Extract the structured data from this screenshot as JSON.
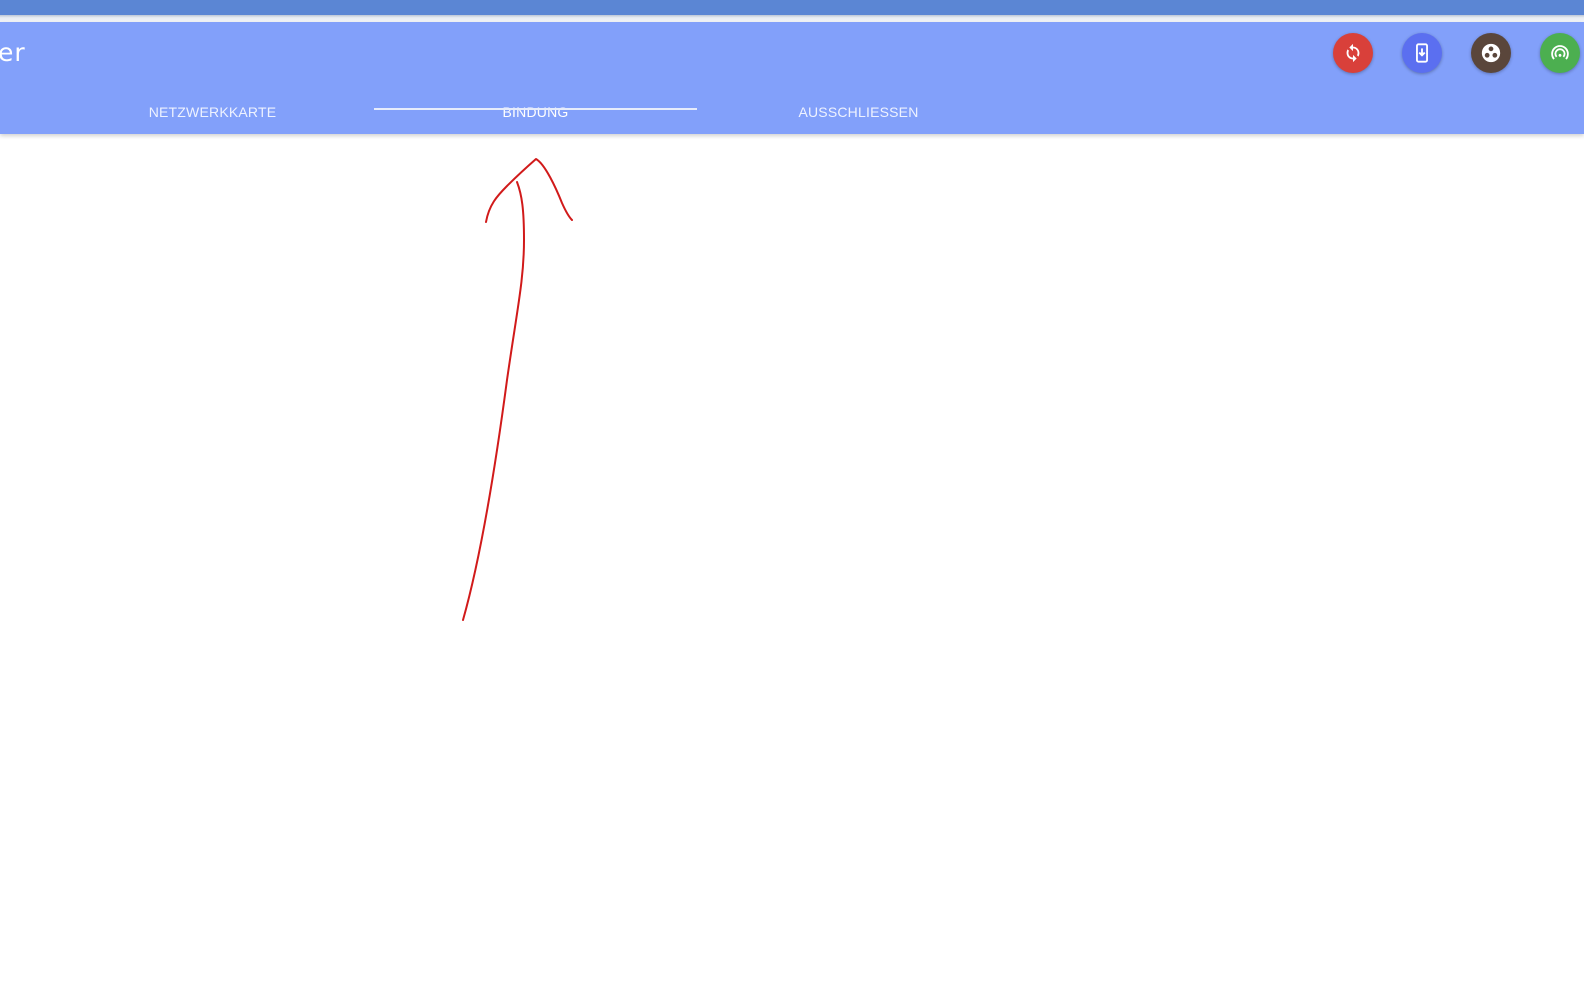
{
  "app_bar": {
    "title": "er",
    "background_color": "#82a0fa",
    "actions": [
      {
        "name": "sync-button",
        "icon": "sync-icon",
        "color": "#d9403a"
      },
      {
        "name": "device-download-button",
        "icon": "phone-download-icon",
        "color": "#5b6ff0"
      },
      {
        "name": "nodes-button",
        "icon": "cluster-icon",
        "color": "#5a463b"
      },
      {
        "name": "wireless-button",
        "icon": "wifi-icon",
        "color": "#4caf50"
      }
    ]
  },
  "tabs": [
    {
      "label": "NETZWERKKARTE",
      "active": false
    },
    {
      "label": "BINDUNG",
      "active": true
    },
    {
      "label": "AUSSCHLIESSEN",
      "active": false
    }
  ],
  "annotation": {
    "icon": "hand-drawn-arrow-icon",
    "color": "#d11a1a"
  }
}
